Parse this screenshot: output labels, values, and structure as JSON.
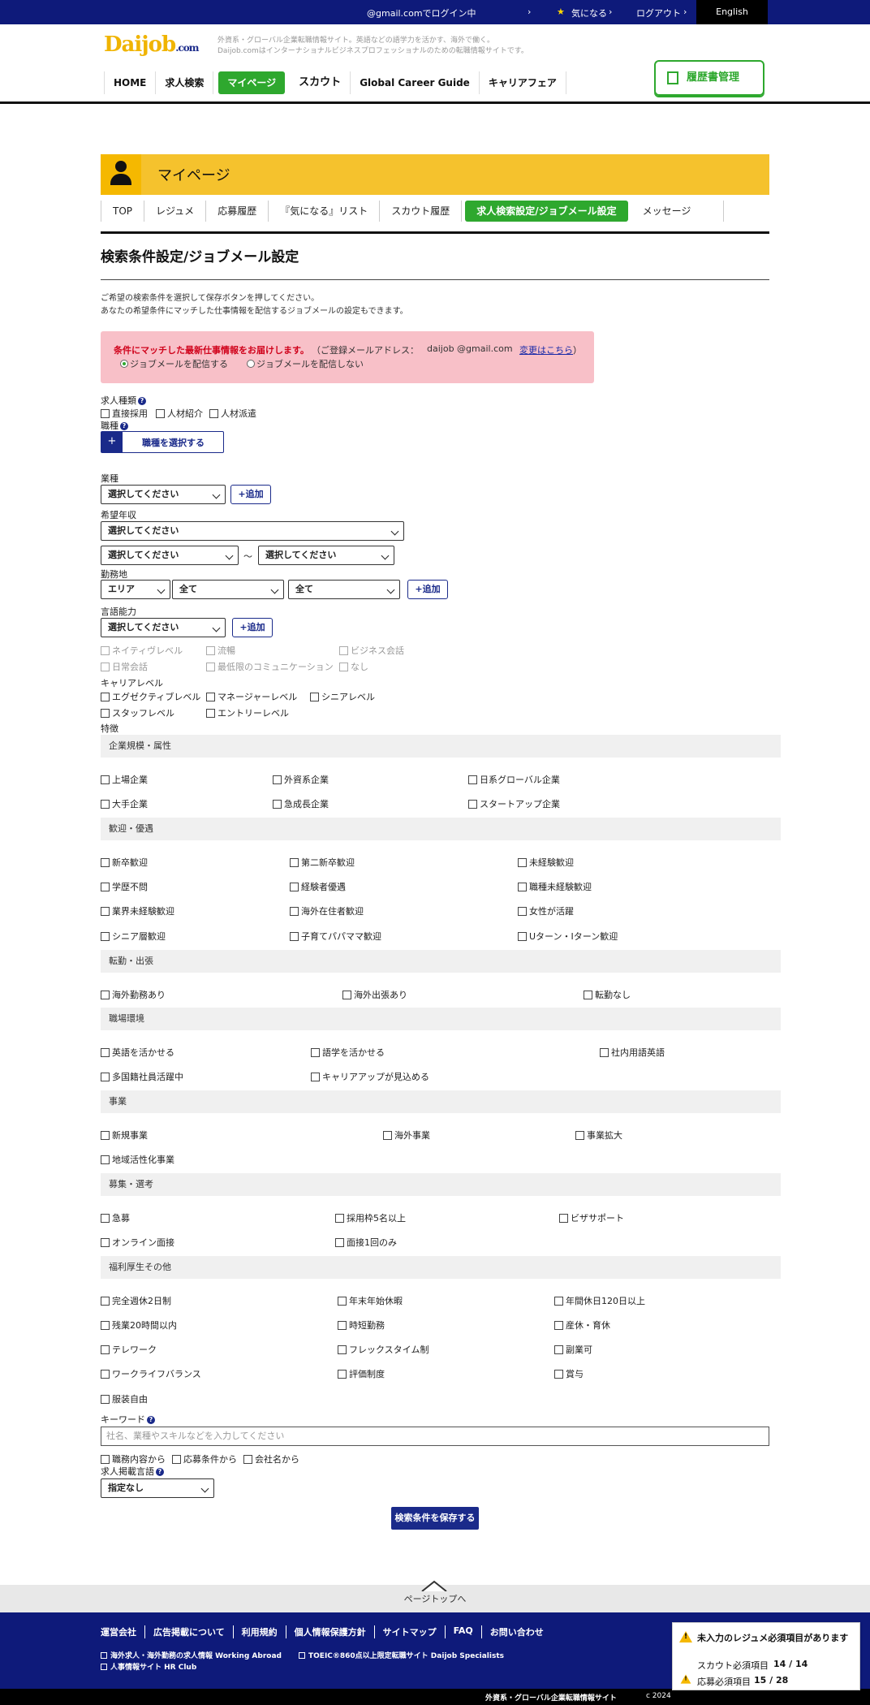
{
  "topbar": {
    "login_status": "@gmail.comでログイン中",
    "favorites": "気になる",
    "logout": "ログアウト",
    "language": "English"
  },
  "header": {
    "logo_main": "Daijob",
    "logo_suffix": ".com",
    "tagline1": "外資系・グローバル企業転職情報サイト。英語などの語学力を活かす、海外で働く。",
    "tagline2": "Daijob.comはインターナショナルビジネスプロフェッショナルのための転職情報サイトです。",
    "resume_button": "履歴書管理",
    "nav": [
      "HOME",
      "求人検索",
      "マイページ",
      "スカウト",
      "Global Career Guide",
      "キャリアフェア"
    ]
  },
  "mypage": {
    "title": "マイページ",
    "tabs": [
      "TOP",
      "レジュメ",
      "応募履歴",
      "『気になる』リスト",
      "スカウト履歴",
      "求人検索設定/ジョブメール設定",
      "メッセージ"
    ]
  },
  "page": {
    "title": "検索条件設定/ジョブメール設定",
    "desc1": "ご希望の検索条件を選択して保存ボタンを押してください。",
    "desc2": "あなたの希望条件にマッチした仕事情報を配信するジョブメールの設定もできます。"
  },
  "jobmail": {
    "notice": "条件にマッチした最新仕事情報をお届けします。",
    "addr_label": "（ご登録メールアドレス：",
    "email": "daijob @gmail.com",
    "change_link": "変更はこちら",
    "close_paren": "）",
    "opt_send": "ジョブメールを配信する",
    "opt_nosend": "ジョブメールを配信しない"
  },
  "form": {
    "job_type_label": "求人種類",
    "job_types": [
      "直接採用",
      "人材紹介",
      "人材派遣"
    ],
    "occupation_label": "職種",
    "occupation_button": "職種を選択する",
    "industry_label": "業種",
    "select_default": "選択してください",
    "add_button": "+追加",
    "salary_label": "希望年収",
    "tilde": "〜",
    "location_label": "勤務地",
    "area": "エリア",
    "all": "全て",
    "language_label": "言語能力",
    "language_levels": [
      "ネイティヴレベル",
      "流暢",
      "ビジネス会話",
      "日常会話",
      "最低限のコミュニケーション",
      "なし"
    ],
    "career_label": "キャリアレベル",
    "career_levels": [
      "エグゼクティブレベル",
      "マネージャーレベル",
      "シニアレベル",
      "スタッフレベル",
      "エントリーレベル"
    ],
    "features_label": "特徴",
    "keyword_label": "キーワード",
    "keyword_placeholder": "社名、業種やスキルなどを入力してください",
    "keyword_scopes": [
      "職務内容から",
      "応募条件から",
      "会社名から"
    ],
    "posting_lang_label": "求人掲載言語",
    "posting_lang_value": "指定なし",
    "save_button": "検索条件を保存する"
  },
  "features": [
    {
      "title": "企業規模・属性",
      "items": [
        "上場企業",
        "外資系企業",
        "日系グローバル企業",
        "大手企業",
        "急成長企業",
        "スタートアップ企業"
      ]
    },
    {
      "title": "歓迎・優遇",
      "items": [
        "新卒歓迎",
        "第二新卒歓迎",
        "未経験歓迎",
        "学歴不問",
        "経験者優遇",
        "職種未経験歓迎",
        "業界未経験歓迎",
        "海外在住者歓迎",
        "女性が活躍",
        "シニア層歓迎",
        "子育てパパママ歓迎",
        "Uターン・Iターン歓迎"
      ]
    },
    {
      "title": "転勤・出張",
      "items": [
        "海外勤務あり",
        "海外出張あり",
        "転勤なし"
      ]
    },
    {
      "title": "職場環境",
      "items": [
        "英語を活かせる",
        "語学を活かせる",
        "社内用語英語",
        "多国籍社員活躍中",
        "キャリアアップが見込める"
      ]
    },
    {
      "title": "事業",
      "items": [
        "新規事業",
        "海外事業",
        "事業拡大",
        "地域活性化事業"
      ]
    },
    {
      "title": "募集・選考",
      "items": [
        "急募",
        "採用枠5名以上",
        "ビザサポート",
        "オンライン面接",
        "面接1回のみ"
      ]
    },
    {
      "title": "福利厚生その他",
      "items": [
        "完全週休2日制",
        "年末年始休暇",
        "年間休日120日以上",
        "残業20時間以内",
        "時短勤務",
        "産休・育休",
        "テレワーク",
        "フレックスタイム制",
        "副業可",
        "ワークライフバランス",
        "評価制度",
        "賞与",
        "服装自由"
      ]
    }
  ],
  "footer": {
    "pagetop": "ページトップへ",
    "links": [
      "運営会社",
      "広告掲載について",
      "利用規約",
      "個人情報保護方針",
      "サイトマップ",
      "FAQ",
      "お問い合わせ"
    ],
    "sites": [
      "海外求人・海外勤務の求人情報 Working Abroad",
      "TOEIC®860点以上限定転職サイト Daijob Specialists",
      "人事情報サイト HR Club"
    ],
    "bottom_text": "外資系・グローバル企業転職情報サイト",
    "copyright": "c 2024"
  },
  "alert": {
    "title": "未入力のレジュメ必須項目があります",
    "scout_label": "スカウト必須項目",
    "scout_value": "14 / 14",
    "apply_label": "応募必須項目",
    "apply_value": "15 / 28"
  },
  "colors": {
    "navy": "#0e1a7a",
    "green": "#2ea82e",
    "yellow": "#f5c22d",
    "pink": "#f8c0c8",
    "red": "#d0021b"
  }
}
